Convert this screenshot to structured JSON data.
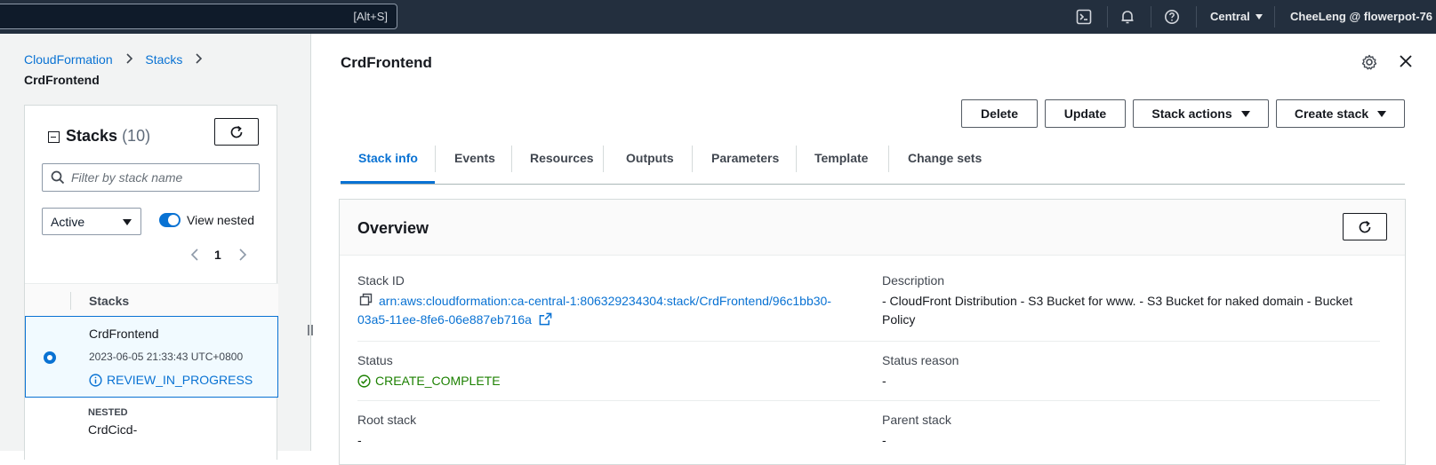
{
  "topnav": {
    "search_shortcut": "[Alt+S]",
    "region": "Central",
    "account": "CheeLeng @ flowerpot-76",
    "icons": [
      "cloudshell-icon",
      "notifications-icon",
      "help-icon"
    ]
  },
  "breadcrumb": {
    "items": [
      "CloudFormation",
      "Stacks"
    ],
    "current": "CrdFrontend"
  },
  "stacks_panel": {
    "title": "Stacks",
    "count": "(10)",
    "filter_placeholder": "Filter by stack name",
    "status_filter": "Active",
    "view_nested_label": "View nested",
    "view_nested_on": true,
    "page": "1",
    "column_header": "Stacks",
    "selected_row": {
      "name": "CrdFrontend",
      "timestamp": "2023-06-05 21:33:43 UTC+0800",
      "status": "REVIEW_IN_PROGRESS"
    },
    "next_row": {
      "tag": "NESTED",
      "name": "CrdCicd-"
    }
  },
  "main": {
    "title": "CrdFrontend",
    "buttons": {
      "delete": "Delete",
      "update": "Update",
      "stack_actions": "Stack actions",
      "create_stack": "Create stack"
    },
    "tabs": [
      "Stack info",
      "Events",
      "Resources",
      "Outputs",
      "Parameters",
      "Template",
      "Change sets"
    ],
    "active_tab": "Stack info"
  },
  "overview": {
    "title": "Overview",
    "stack_id_label": "Stack ID",
    "stack_id_line1": "arn:aws:cloudformation:ca-central-1:806329234304:stack/CrdFrontend/96c1bb30-",
    "stack_id_line2": "03a5-11ee-8fe6-06e887eb716a",
    "description_label": "Description",
    "description_line1": "- CloudFront Distribution - S3 Bucket for www. - S3 Bucket for naked domain - Bucket",
    "description_line2": "Policy",
    "status_label": "Status",
    "status_value": "CREATE_COMPLETE",
    "status_reason_label": "Status reason",
    "status_reason_value": "-",
    "root_stack_label": "Root stack",
    "root_stack_value": "-",
    "parent_stack_label": "Parent stack",
    "parent_stack_value": "-"
  },
  "colors": {
    "topnav_bg": "#232f3e",
    "link": "#0972d3",
    "success": "#1d8102"
  }
}
